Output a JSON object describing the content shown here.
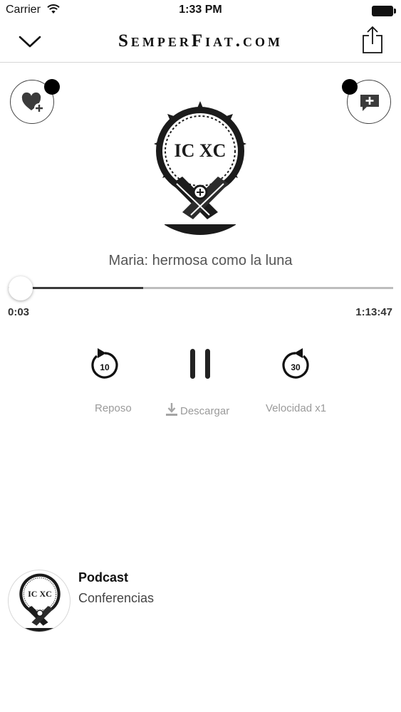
{
  "status_bar": {
    "carrier": "Carrier",
    "time": "1:33 PM",
    "wifi_icon": "wifi-icon",
    "battery_icon": "battery-icon"
  },
  "nav": {
    "back_icon": "chevron-down-icon",
    "brand": "SemperFiat.com",
    "share_icon": "share-icon"
  },
  "actions": {
    "favorite_icon": "heart-plus-icon",
    "comment_icon": "comment-plus-icon"
  },
  "artwork": {
    "monogram": "IC XC",
    "logo_icon": "icxc-emblem-icon"
  },
  "track": {
    "title": "Maria: hermosa como la luna"
  },
  "progress": {
    "elapsed": "0:03",
    "total": "1:13:47",
    "played_fraction": 0.0007,
    "buffered_fraction": 0.35
  },
  "controls": {
    "rewind_seconds": "10",
    "forward_seconds": "30",
    "rewind_icon": "rewind-10-icon",
    "pause_icon": "pause-icon",
    "forward_icon": "forward-30-icon"
  },
  "options": {
    "repose": "Reposo",
    "download": "Descargar",
    "download_icon": "download-icon",
    "speed": "Velocidad x1"
  },
  "podcast": {
    "title": "Podcast",
    "subtitle": "Conferencias"
  },
  "colors": {
    "text_dark": "#111111",
    "text_muted": "#9a9a9a",
    "track_bg": "#bdbdbd",
    "badge": "#000000"
  }
}
